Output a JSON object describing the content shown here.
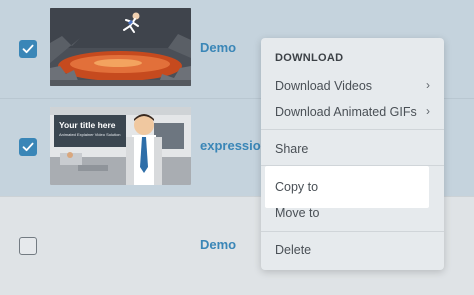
{
  "rows": [
    {
      "title": "Demo",
      "checked": true
    },
    {
      "title": "expression",
      "checked": true,
      "thumbnail_text": {
        "title": "Your title here",
        "subtitle": "Animated Explainer Video Solution"
      }
    },
    {
      "title": "Demo",
      "checked": false
    }
  ],
  "menu": {
    "header": "DOWNLOAD",
    "items": [
      {
        "label": "Download Videos",
        "has_submenu": true
      },
      {
        "label": "Download Animated GIFs",
        "has_submenu": true
      },
      {
        "label": "Share"
      },
      {
        "label": "Copy to",
        "highlighted": true
      },
      {
        "label": "Move to"
      },
      {
        "label": "Delete"
      }
    ],
    "submenu_glyph": "›"
  },
  "colors": {
    "accent": "#3a86b7",
    "row_selected": "#c5d3dd",
    "menu_bg": "#e6eaed",
    "highlight": "#ffffff"
  }
}
